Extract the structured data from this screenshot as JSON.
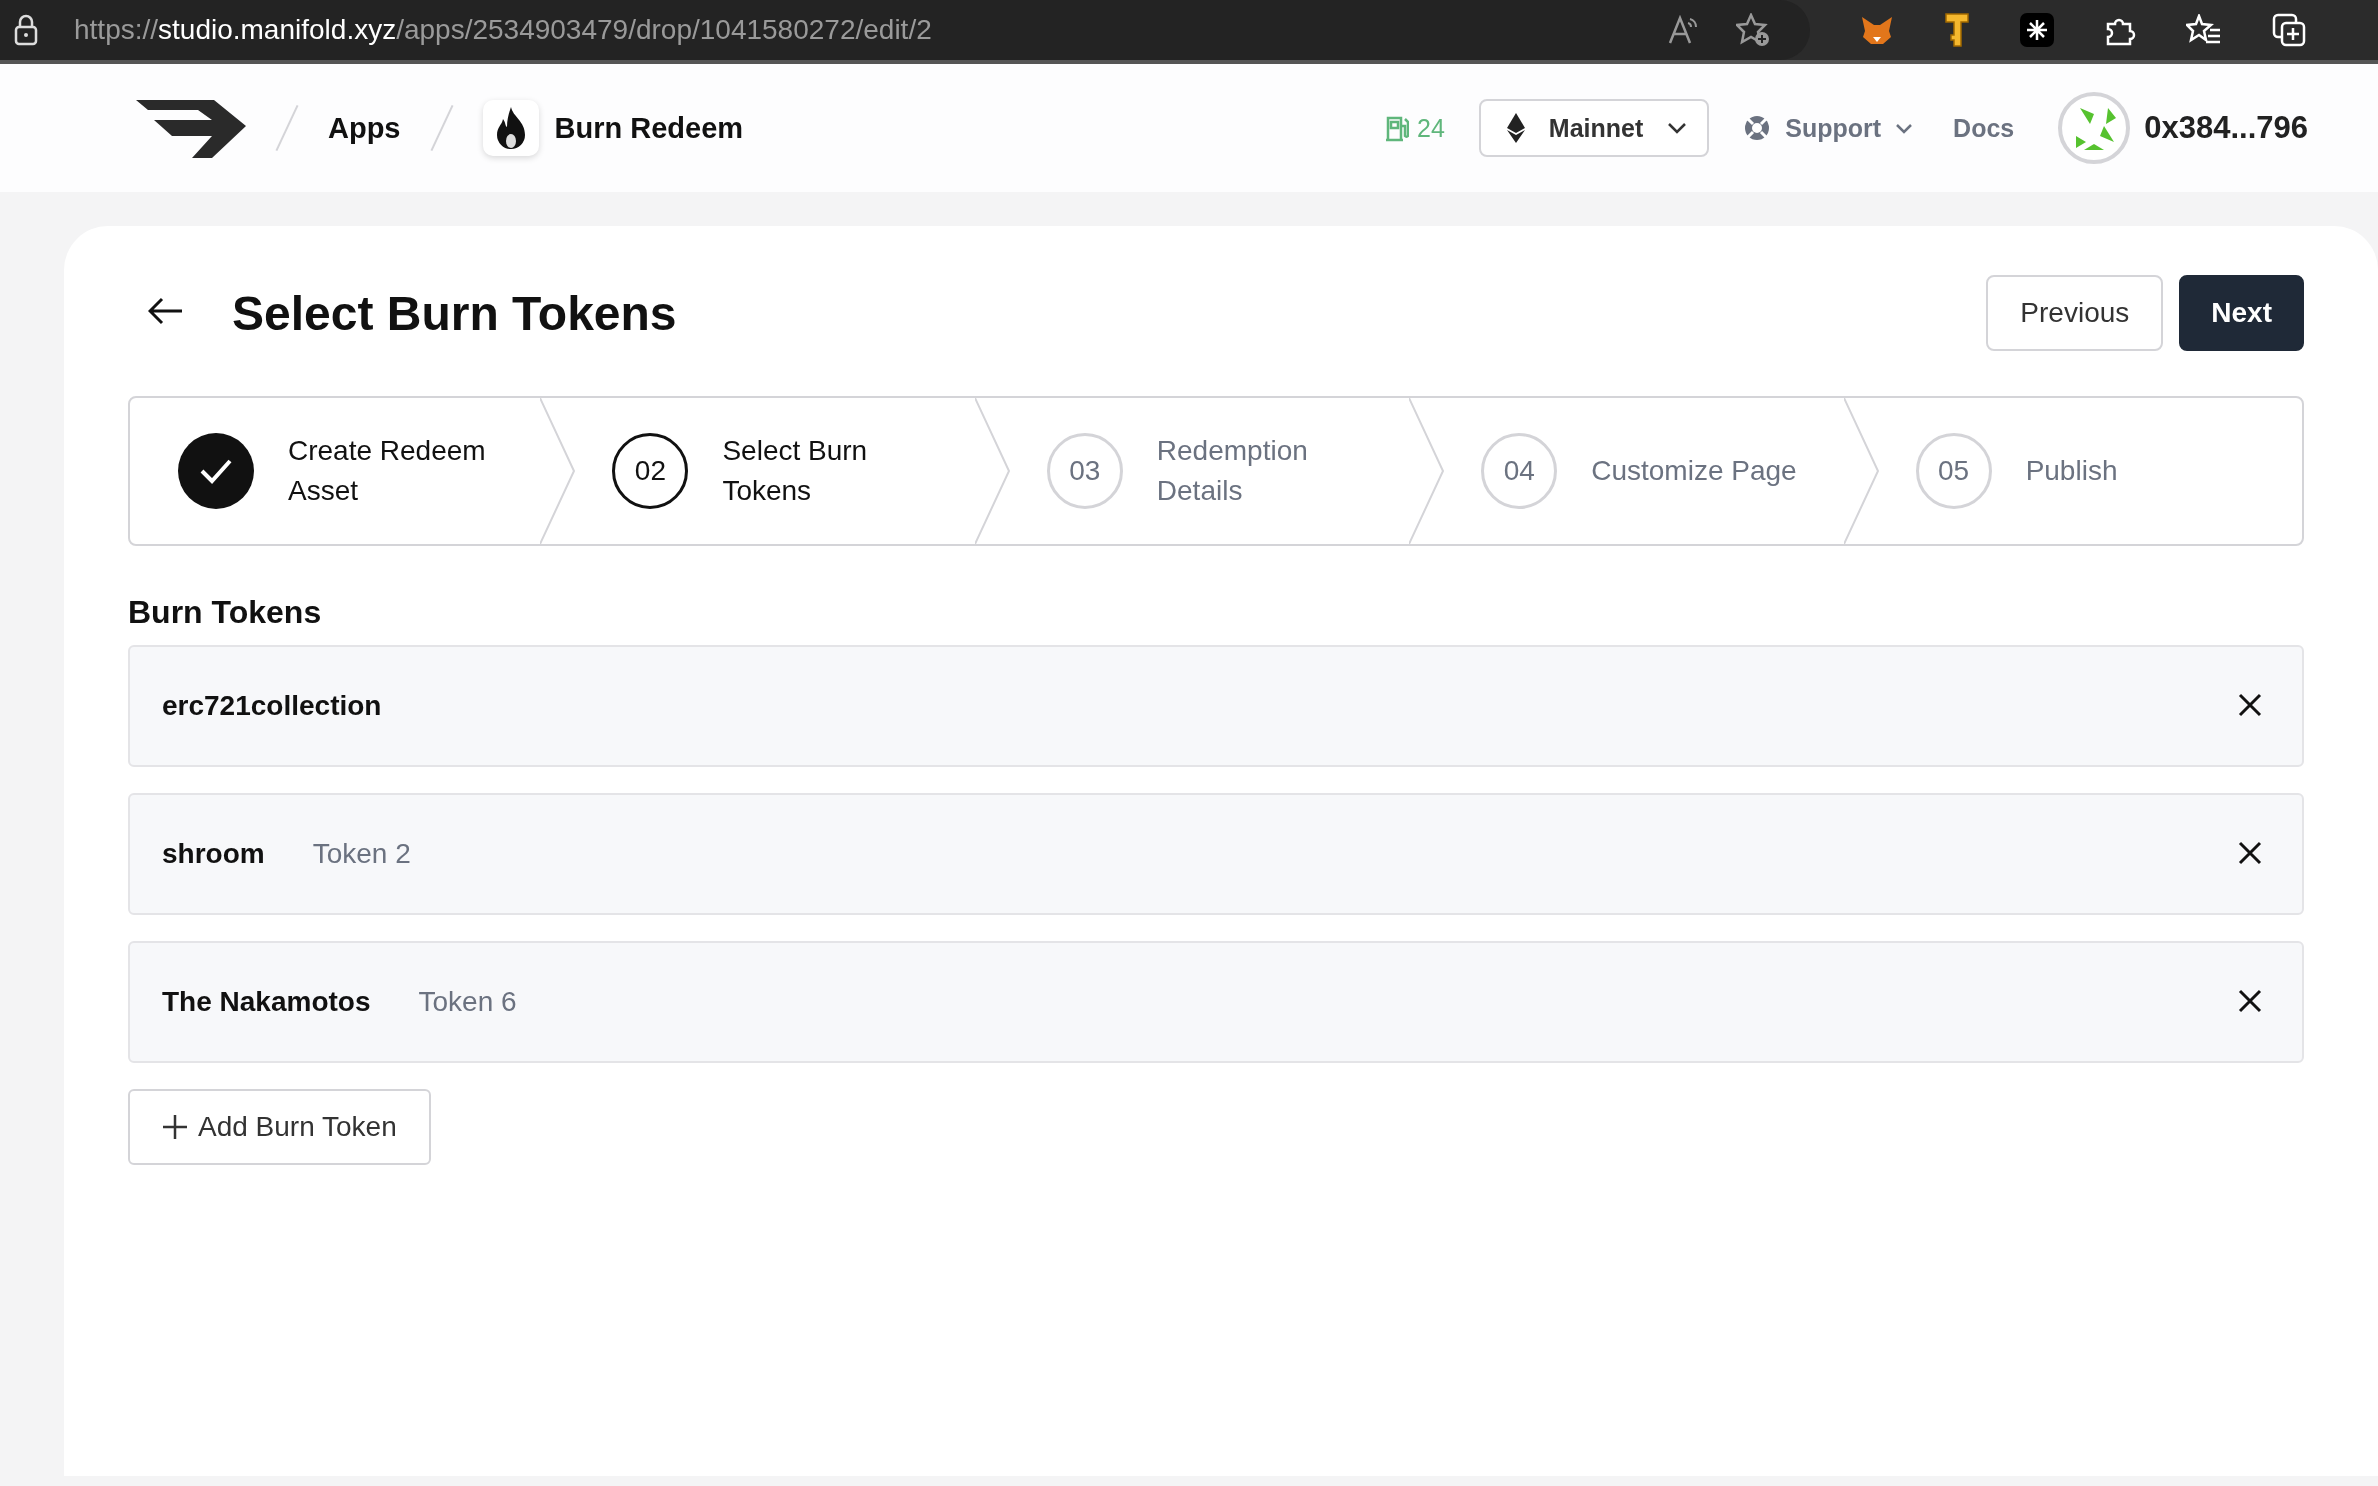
{
  "browser": {
    "url_scheme": "https://",
    "url_host": "studio.manifold.xyz",
    "url_path": "/apps/2534903479/drop/1041580272/edit/2"
  },
  "header": {
    "breadcrumbs": [
      {
        "label": "Apps",
        "kind": "text"
      },
      {
        "label": "Burn Redeem",
        "kind": "app"
      }
    ],
    "gas": "24",
    "network": "Mainnet",
    "support": "Support",
    "docs": "Docs",
    "account": "0x384...796"
  },
  "page": {
    "title": "Select Burn Tokens",
    "buttons": [
      {
        "label": "Previous",
        "kind": "secondary"
      },
      {
        "label": "Next",
        "kind": "primary"
      }
    ]
  },
  "steps": [
    {
      "label": "Create Redeem Asset",
      "completed": true,
      "selected": false
    },
    {
      "number": "02",
      "label": "Select Burn Tokens",
      "completed": false,
      "selected": true
    },
    {
      "number": "03",
      "label": "Redemption Details",
      "completed": false,
      "selected": false
    },
    {
      "number": "04",
      "label": "Customize Page",
      "completed": false,
      "selected": false
    },
    {
      "number": "05",
      "label": "Publish",
      "completed": false,
      "selected": false
    }
  ],
  "burn_tokens": {
    "heading": "Burn Tokens",
    "items": [
      {
        "name": "erc721collection"
      },
      {
        "name": "shroom",
        "token": "Token 2"
      },
      {
        "name": "The Nakamotos",
        "token": "Token 6"
      }
    ],
    "add_button": "Add Burn Token"
  }
}
